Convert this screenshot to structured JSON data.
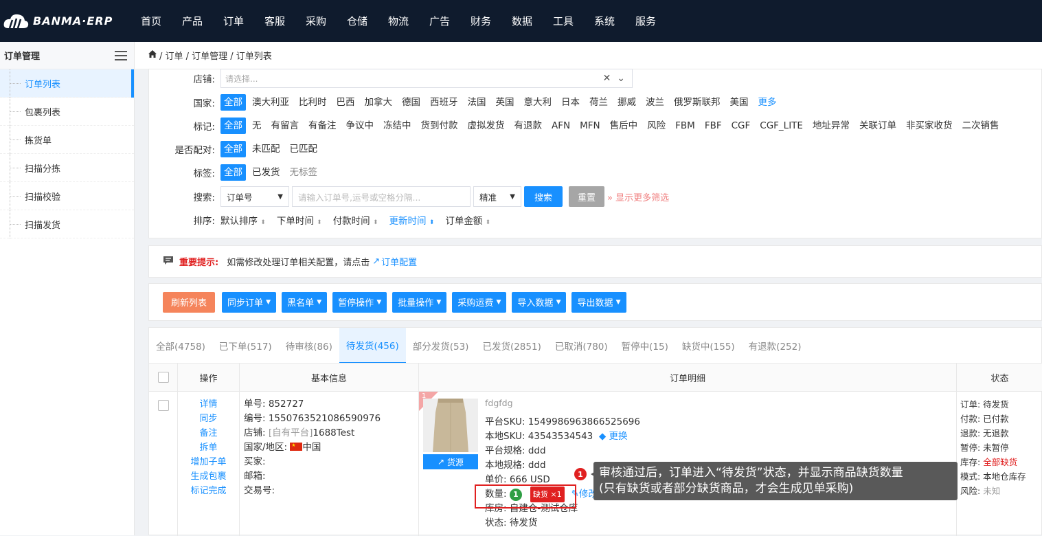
{
  "nav": {
    "logo": "BANMA·ERP",
    "items": [
      "首页",
      "产品",
      "订单",
      "客服",
      "采购",
      "仓储",
      "物流",
      "广告",
      "财务",
      "数据",
      "工具",
      "系统",
      "服务"
    ]
  },
  "sidebar": {
    "title": "订单管理",
    "items": [
      "订单列表",
      "包裹列表",
      "拣货单",
      "扫描分拣",
      "扫描校验",
      "扫描发货"
    ]
  },
  "breadcrumb": "/ 订单 / 订单管理 / 订单列表",
  "filters": {
    "store_label": "店铺:",
    "store_placeholder": "请选择...",
    "country_label": "国家:",
    "countries": [
      "全部",
      "澳大利亚",
      "比利时",
      "巴西",
      "加拿大",
      "德国",
      "西班牙",
      "法国",
      "英国",
      "意大利",
      "日本",
      "荷兰",
      "挪威",
      "波兰",
      "俄罗斯联邦",
      "美国"
    ],
    "country_more": "更多",
    "mark_label": "标记:",
    "marks": [
      "全部",
      "无",
      "有留言",
      "有备注",
      "争议中",
      "冻结中",
      "货到付款",
      "虚拟发货",
      "有退款",
      "AFN",
      "MFN",
      "售后中",
      "风险",
      "FBM",
      "FBF",
      "CGF",
      "CGF_LITE",
      "地址异常",
      "关联订单",
      "非买家收货",
      "二次销售"
    ],
    "match_label": "是否配对:",
    "match": [
      "全部",
      "未匹配",
      "已匹配"
    ],
    "tag_label": "标签:",
    "tags": [
      "全部",
      "已发货",
      "无标签"
    ],
    "search_label": "搜索:",
    "search_field": "订单号",
    "search_placeholder": "请输入订单号,运号或空格分隔...",
    "search_mode": "精准",
    "search_btn": "搜索",
    "reset_btn": "重置",
    "more_filters": "显示更多筛选",
    "sort_label": "排序:",
    "sorts": [
      "默认排序",
      "下单时间",
      "付款时间",
      "更新时间",
      "订单金额"
    ]
  },
  "tip": {
    "title": "重要提示:",
    "text": "如需修改处理订单相关配置，请点击",
    "link": "订单配置"
  },
  "toolbar": {
    "refresh": "刷新列表",
    "buttons": [
      "同步订单",
      "黑名单",
      "暂停操作",
      "批量操作",
      "采购运费",
      "导入数据",
      "导出数据"
    ]
  },
  "tabs": [
    "全部(4758)",
    "已下单(517)",
    "待审核(86)",
    "待发货(456)",
    "部分发货(53)",
    "已发货(2851)",
    "已取消(780)",
    "暂停中(15)",
    "缺货中(155)",
    "有退款(252)"
  ],
  "table": {
    "headers": {
      "op": "操作",
      "basic": "基本信息",
      "detail": "订单明细",
      "status": "状态"
    },
    "ops": [
      "详情",
      "同步",
      "备注",
      "拆单",
      "增加子单",
      "生成包裹",
      "标记完成"
    ],
    "basic": {
      "order_no": "单号: 852727",
      "serial": "编号: 1550763521086590976",
      "store_prefix": "店铺: ",
      "store_platform": "[自有平台]",
      "store_name": "1688Test",
      "country": "国家/地区: ",
      "country_name": "中国",
      "buyer": "买家:",
      "email": "邮箱:",
      "trade_no": "交易号:"
    },
    "detail": {
      "corner": "1",
      "product_name": "fdgfdg",
      "source_btn": "货源",
      "platform_sku": "平台SKU:  1549986963866525696",
      "local_sku": "本地SKU:  43543534543",
      "replace": "更换",
      "platform_spec": "平台规格:  ddd",
      "local_spec": "本地规格:  ddd",
      "price": "单价:  666 USD",
      "qty_label": "数量:",
      "qty": "1",
      "stockout": "缺货 ×1",
      "edit": "修改",
      "warehouse": "库房:  自建仓-测试仓库",
      "state": "状态:  待发货"
    },
    "status": {
      "order": "订单: 待发货",
      "pay": "付款: 已付款",
      "refund": "退款: 无退款",
      "pause": "暂停: 未暂停",
      "stock_label": "库存: ",
      "stock_value": "全部缺货",
      "mode": "模式: 本地仓库存",
      "risk_label": "风险: ",
      "risk_value": "未知"
    }
  },
  "callout": {
    "num": "1",
    "line1": "审核通过后，订单进入“待发货”状态，并显示商品缺货数量",
    "line2": "(只有缺货或者部分缺货商品，才会生成见单采购)"
  },
  "colors": {
    "primary": "#1890ff",
    "nav": "#0f1b2d",
    "red": "#e02020",
    "orange": "#f5845b"
  }
}
